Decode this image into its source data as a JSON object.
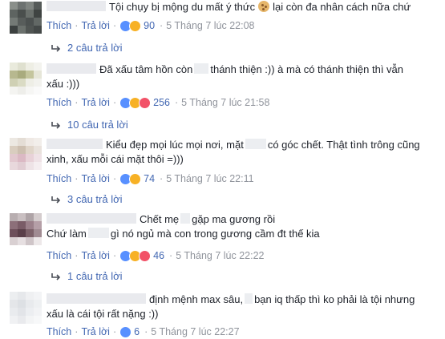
{
  "comments": [
    {
      "text_parts": [
        "Tội chụy bị mộng du mất ý thức",
        "lại còn đa nhân cách nữa chứ"
      ],
      "like_label": "Thích",
      "reply_label": "Trả lời",
      "reaction_count": "90",
      "time": "5 Tháng 7 lúc 22:08",
      "replies_label": "2 câu trả lời"
    },
    {
      "text_parts": [
        "Đã xấu tâm hồn còn",
        "thánh thiện :)) à mà có thánh thiện thì vẫn",
        "xấu :)))"
      ],
      "like_label": "Thích",
      "reply_label": "Trả lời",
      "reaction_count": "256",
      "time": "5 Tháng 7 lúc 21:58",
      "replies_label": "10 câu trả lời"
    },
    {
      "text_parts": [
        "Kiểu đẹp mọi lúc mọi nơi, mặt",
        "có góc chết. Thật tình trông cũng",
        "xinh, xấu mỗi cái mặt thôi =)))"
      ],
      "like_label": "Thích",
      "reply_label": "Trả lời",
      "reaction_count": "74",
      "time": "5 Tháng 7 lúc 22:11",
      "replies_label": "3 câu trả lời"
    },
    {
      "text_parts": [
        "Chết mẹ",
        "gặp ma gương rồi",
        "Chứ làm",
        "gì nó ngủ mà con trong gương cầm đt thế kia"
      ],
      "like_label": "Thích",
      "reply_label": "Trả lời",
      "reaction_count": "46",
      "time": "5 Tháng 7 lúc 22:22",
      "replies_label": "1 câu trả lời"
    },
    {
      "text_parts": [
        "định mệnh max sâu,",
        "bạn iq thấp thì ko phải là tội nhưng",
        "xấu là cái tội rất nặng :))"
      ],
      "like_label": "Thích",
      "reply_label": "Trả lời",
      "reaction_count": "6",
      "time": "5 Tháng 7 lúc 22:27"
    }
  ],
  "colors": {
    "link": "#4267b2",
    "meta": "#90949c",
    "text": "#1d2129",
    "like": "#5890ff",
    "haha": "#f7b125",
    "love": "#f25268"
  },
  "icons": [
    "like-reaction-icon",
    "haha-reaction-icon",
    "love-reaction-icon",
    "reply-arrow-icon",
    "cookie-emoji-icon"
  ]
}
